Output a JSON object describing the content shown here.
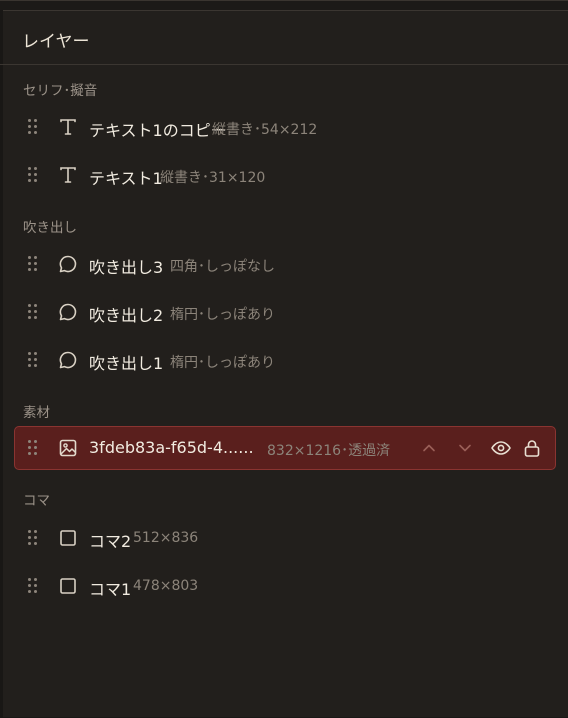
{
  "panel": {
    "title": "レイヤー"
  },
  "sections": [
    {
      "label": "セリフ･擬音",
      "items": [
        {
          "name": "テキスト1のコピー",
          "meta": "縦書き･54×212",
          "icon": "text-icon"
        },
        {
          "name": "テキスト1",
          "meta": "縦書き･31×120",
          "icon": "text-icon"
        }
      ]
    },
    {
      "label": "吹き出し",
      "items": [
        {
          "name": "吹き出し3",
          "meta": "四角･しっぽなし",
          "icon": "speech-bubble-icon"
        },
        {
          "name": "吹き出し2",
          "meta": "楕円･しっぽあり",
          "icon": "speech-bubble-icon"
        },
        {
          "name": "吹き出し1",
          "meta": "楕円･しっぽあり",
          "icon": "speech-bubble-icon"
        }
      ]
    },
    {
      "label": "素材",
      "items": [
        {
          "name": "3fdeb83a-f65d-4......",
          "meta": "832×1216･透過済",
          "icon": "image-icon",
          "selected": true
        }
      ]
    },
    {
      "label": "コマ",
      "items": [
        {
          "name": "コマ2",
          "meta": "512×836",
          "icon": "square-icon"
        },
        {
          "name": "コマ1",
          "meta": "478×803",
          "icon": "square-icon"
        }
      ]
    }
  ],
  "colors": {
    "background": "#221f1c",
    "selected_background": "#5a1f1d",
    "selected_border": "#8a3431",
    "text_primary": "#f1ebe0",
    "text_secondary": "#8c847a"
  }
}
